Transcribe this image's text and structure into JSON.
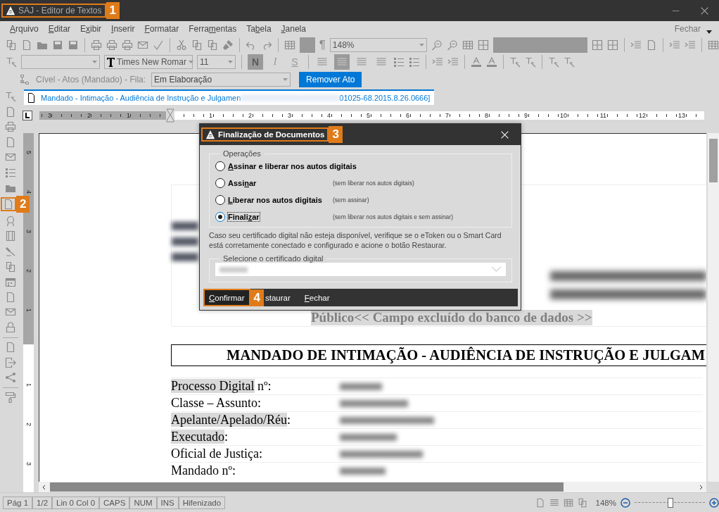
{
  "window": {
    "title": "SAJ - Editor de Textos",
    "callout": "1"
  },
  "menu": {
    "items": [
      {
        "key": "A",
        "post": "rquivo"
      },
      {
        "key": "E",
        "post": "ditar"
      },
      {
        "pre": "E",
        "key": "x",
        "post": "ibir"
      },
      {
        "key": "I",
        "post": "nserir"
      },
      {
        "key": "F",
        "post": "ormatar"
      },
      {
        "pre": "Ferra",
        "key": "m",
        "post": "entas"
      },
      {
        "pre": "Ta",
        "key": "b",
        "post": "ela"
      },
      {
        "key": "J",
        "post": "anela"
      }
    ],
    "close": "Fechar"
  },
  "toolbar": {
    "pilcrow": "¶",
    "zoom": "148%",
    "font_name": "Times New Romar",
    "font_size": "11",
    "style_buttons": [
      {
        "label": "N",
        "kind": "bold",
        "pressed": true
      },
      {
        "label": "I",
        "kind": "italic",
        "pressed": false
      },
      {
        "label": "S",
        "kind": "strike",
        "pressed": false
      }
    ],
    "alignment": [
      {
        "selected": false
      },
      {
        "selected": true
      },
      {
        "selected": false
      },
      {
        "selected": false
      }
    ]
  },
  "queue": {
    "label": "Cível - Atos (Mandado) - Fila:",
    "value": "Em Elaboração",
    "button": "Remover Ato"
  },
  "side_tools": {
    "callout": "2"
  },
  "tab": {
    "label_start": "Mandado - Intimação - Audiência de Instrução e Julgamen",
    "label_end": "01025-68.2015.8.26.0666]"
  },
  "ruler": {
    "left_numbers": [
      "3",
      "2",
      "1"
    ],
    "right_numbers": [
      "1",
      "2",
      "3",
      "4",
      "5",
      "6",
      "7",
      "8",
      "9",
      "10",
      "11",
      "12",
      "13"
    ]
  },
  "vertical_ruler": {
    "upper_numbers": [
      "5",
      "4",
      "3",
      "2",
      "1"
    ],
    "lower_numbers": [
      "1",
      "2",
      "3"
    ]
  },
  "document": {
    "header_note": "Público<< Campo excluído do banco de dados >>",
    "heading": "MANDADO DE INTIMAÇÃO - AUDIÊNCIA DE INSTRUÇÃO E JULGAM",
    "fields": [
      {
        "label": "Processo Digital",
        "suffix": " nº:",
        "highlighted": true
      },
      {
        "label": "Classe – Assunto:",
        "highlighted": false
      },
      {
        "label": "Apelante/Apelado/Réu",
        "suffix": ":",
        "highlighted": true
      },
      {
        "label": "Executado",
        "suffix": ":",
        "highlighted": true
      },
      {
        "label": "Oficial de Justiça:",
        "highlighted": false
      },
      {
        "label": "Mandado nº:",
        "highlighted": false
      }
    ]
  },
  "dialog": {
    "title": "Finalização de Documentos",
    "callout": "3",
    "group": "Operações",
    "options": [
      {
        "key": "A",
        "post": "ssinar e liberar nos autos digitais",
        "selected": false
      },
      {
        "pre": "Assi",
        "key": "n",
        "post": "ar",
        "note": "(sem liberar nos autos digitais)",
        "selected": false
      },
      {
        "key": "L",
        "post": "iberar nos autos digitais",
        "note": "(sem assinar)",
        "selected": false
      },
      {
        "pre": "Finali",
        "key": "z",
        "post": "ar",
        "note": "(sem liberar nos autos digitais e sem assinar)",
        "selected": true
      }
    ],
    "info": "Caso seu certificado digital não esteja disponível, verifique se o eToken ou o Smart Card está corretamente conectado e configurado e acione o botão Restaurar.",
    "certificate_group": "Selecione o certificado digital",
    "buttons": [
      {
        "key": "C",
        "post": "onfirmar",
        "kind": "default",
        "callout": "4"
      },
      {
        "pre": "staurar",
        "kind": "flat"
      },
      {
        "key": "F",
        "post": "echar",
        "kind": "flat"
      }
    ]
  },
  "status_bar": {
    "cells": [
      "Pág 1",
      "1/2",
      "Lin 0  Col 0",
      "CAPS",
      "NUM",
      "INS",
      "Hifenizado"
    ],
    "zoom": "148%",
    "zoom_slider": {
      "level": 0.5
    }
  }
}
